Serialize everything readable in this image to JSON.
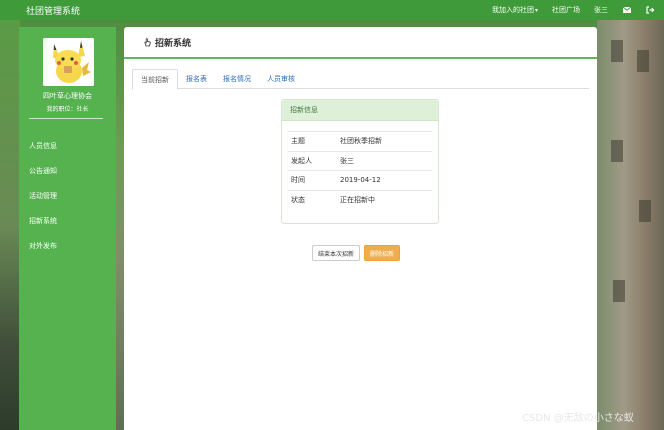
{
  "navbar": {
    "brand": "社团管理系统",
    "my_clubs": "我加入的社团",
    "club_square": "社团广场",
    "user": "张三"
  },
  "sidebar": {
    "org_name": "四叶草心理协会",
    "role": "我的职位：社长",
    "items": [
      {
        "label": "人员信息"
      },
      {
        "label": "公告通知"
      },
      {
        "label": "活动管理"
      },
      {
        "label": "招新系统"
      },
      {
        "label": "对外发布"
      }
    ]
  },
  "panel": {
    "title": "招新系统",
    "tabs": [
      {
        "label": "当前招新"
      },
      {
        "label": "报名表"
      },
      {
        "label": "报名情况"
      },
      {
        "label": "人员审核"
      }
    ]
  },
  "info": {
    "heading": "招新信息",
    "rows": [
      {
        "key": "主题",
        "value": "社团秋季招新"
      },
      {
        "key": "发起人",
        "value": "张三"
      },
      {
        "key": "时间",
        "value": "2019-04-12"
      },
      {
        "key": "状态",
        "value": "正在招新中"
      }
    ]
  },
  "actions": {
    "end_label": "结束本次招新",
    "delete_label": "删除招新"
  },
  "watermark": "CSDN @无敌の小さな蚁",
  "colors": {
    "navbar": "#3f9a3a",
    "sidebar": "#55b24f",
    "accent": "#5cb85c",
    "warning": "#f0ad4e"
  }
}
